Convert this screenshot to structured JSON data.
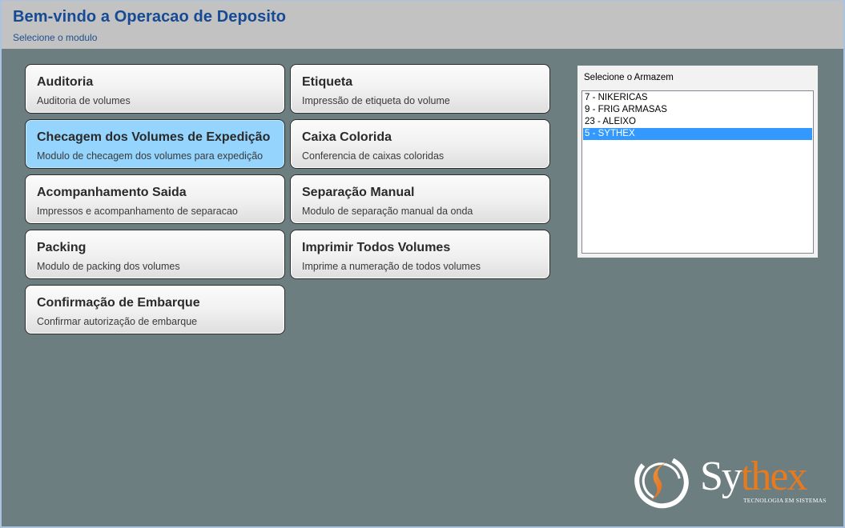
{
  "header": {
    "title": "Bem-vindo a Operacao de Deposito",
    "subtitle": "Selecione o modulo"
  },
  "modules": [
    {
      "title": "Auditoria",
      "description": "Auditoria de volumes",
      "selected": false
    },
    {
      "title": "Etiqueta",
      "description": "Impressão de etiqueta do volume",
      "selected": false
    },
    {
      "title": "Checagem dos Volumes de Expedição",
      "description": "Modulo de checagem dos volumes para expedição",
      "selected": true
    },
    {
      "title": "Caixa Colorida",
      "description": "Conferencia de caixas coloridas",
      "selected": false
    },
    {
      "title": "Acompanhamento Saida",
      "description": "Impressos e acompanhamento de separacao",
      "selected": false
    },
    {
      "title": "Separação Manual",
      "description": "Modulo de separação manual da onda",
      "selected": false
    },
    {
      "title": "Packing",
      "description": "Modulo de packing dos volumes",
      "selected": false
    },
    {
      "title": "Imprimir Todos Volumes",
      "description": "Imprime a numeração de todos volumes",
      "selected": false
    },
    {
      "title": "Confirmação de Embarque",
      "description": "Confirmar autorização de embarque",
      "selected": false
    }
  ],
  "warehouse": {
    "label": "Selecione o Armazem",
    "items": [
      "7 - NIKERICAS",
      "9 - FRIG ARMASAS",
      "23 - ALEIXO",
      "5 - SYTHEX"
    ],
    "selected_index": 3
  },
  "logo": {
    "word_part1": "Sy",
    "word_part2": "thex",
    "tagline": "TECNOLOGIA EM SISTEMAS"
  },
  "colors": {
    "background": "#6d7e80",
    "header_background": "#c2c2c2",
    "title_color": "#164a94",
    "selected_module": "#94d4fd",
    "selected_list_item": "#3399ff",
    "logo_accent": "#e87a1e"
  },
  "icons": {
    "logo_mark": "sythex-swirl-logo-icon"
  }
}
